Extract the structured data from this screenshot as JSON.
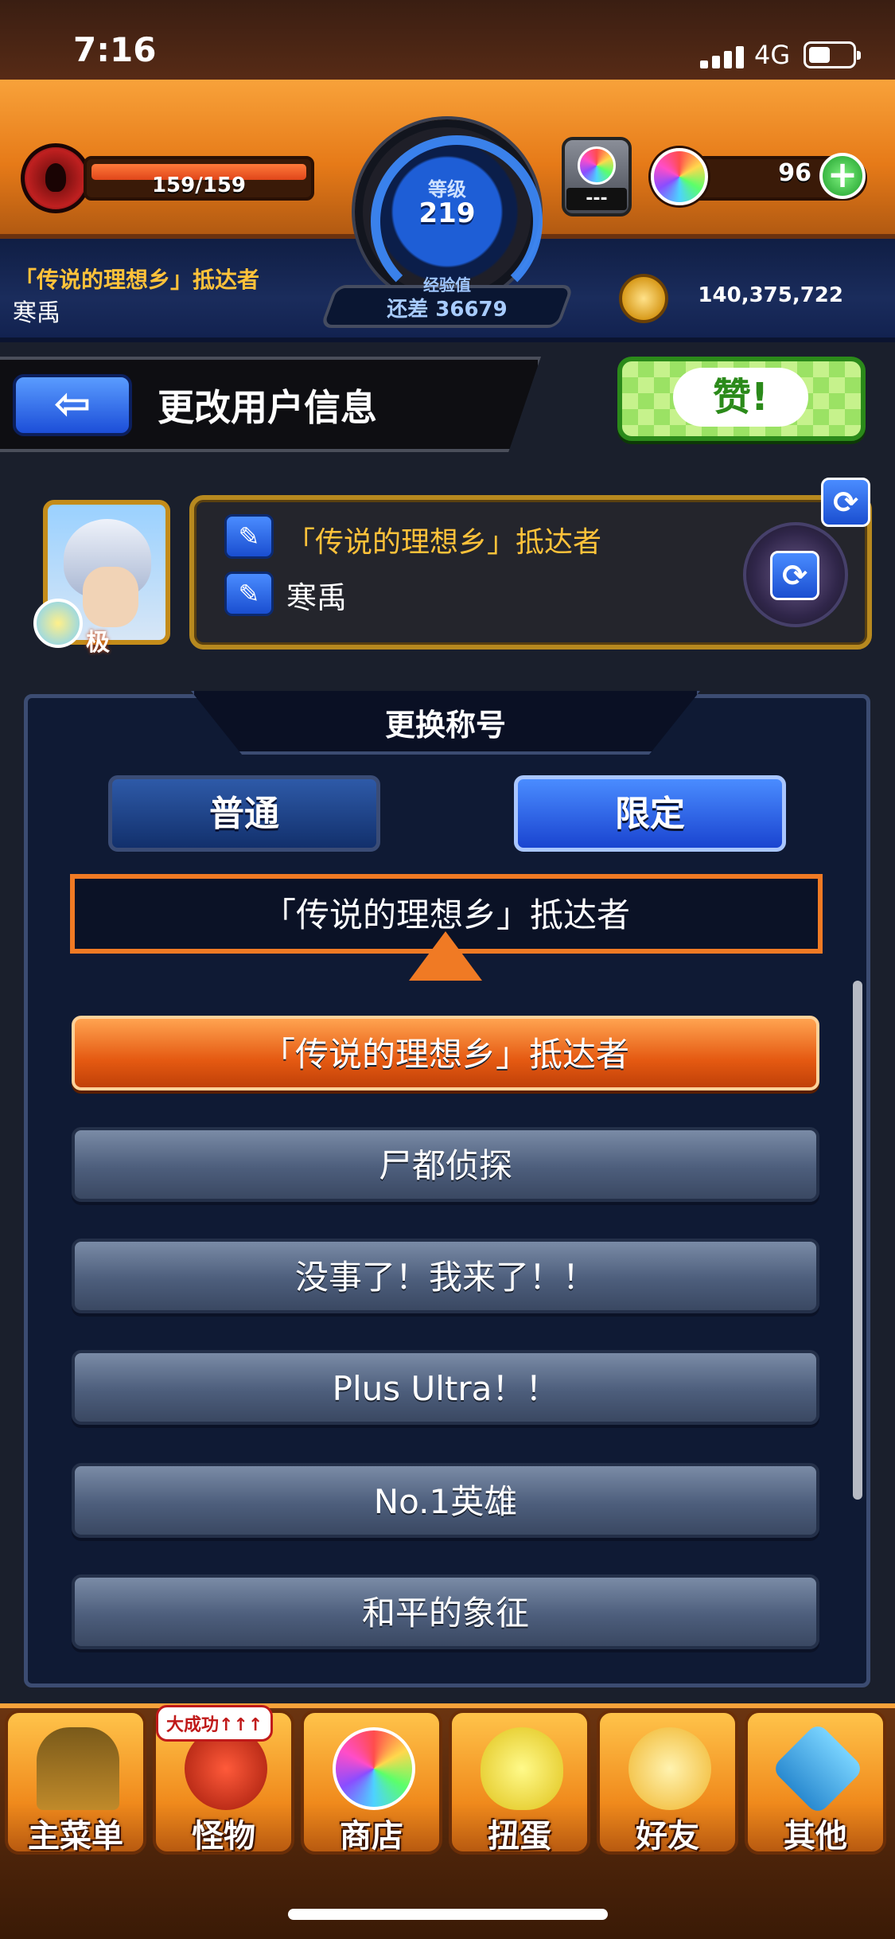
{
  "status_bar": {
    "time": "7:16",
    "network": "4G"
  },
  "hud": {
    "stamina": "159/159",
    "level_label": "等级",
    "level": "219",
    "exp_label": "经验值",
    "exp_remaining": "还差 36679",
    "gacha_count": "---",
    "orb_count": "96",
    "orb_add": "+",
    "player_title": "「传说的理想乡」抵达者",
    "player_name": "寒禹",
    "coins": "140,375,722"
  },
  "header": {
    "back_arrow": "⇦",
    "page_title": "更改用户信息",
    "like_label": "赞!"
  },
  "profile": {
    "grade": "极",
    "title": "「传说的理想乡」抵达者",
    "name": "寒禹",
    "edit_glyph": "✎",
    "swap_glyph": "⟳"
  },
  "title_panel": {
    "heading": "更换称号",
    "tabs": [
      {
        "label": "普通",
        "selected": false
      },
      {
        "label": "限定",
        "selected": true
      }
    ],
    "selected_title": "「传说的理想乡」抵达者",
    "items": [
      {
        "label": "「传说的理想乡」抵达者",
        "active": true
      },
      {
        "label": "尸都侦探",
        "active": false
      },
      {
        "label": "没事了！我来了！！",
        "active": false
      },
      {
        "label": "Plus Ultra！！",
        "active": false
      },
      {
        "label": "No.1英雄",
        "active": false
      },
      {
        "label": "和平的象征",
        "active": false
      }
    ]
  },
  "bottom_nav": {
    "badge": "大成功↑↑↑",
    "items": [
      {
        "label": "主菜单",
        "icon": "gate-icon"
      },
      {
        "label": "怪物",
        "icon": "monster-icon"
      },
      {
        "label": "商店",
        "icon": "orb-icon"
      },
      {
        "label": "扭蛋",
        "icon": "egg-icon"
      },
      {
        "label": "好友",
        "icon": "balloons-icon"
      },
      {
        "label": "其他",
        "icon": "question-icon"
      }
    ]
  },
  "colors": {
    "accent_orange": "#f07a24",
    "panel_navy": "#0f1a34",
    "tab_blue": "#1a44d0",
    "title_gold": "#ffc23a"
  }
}
